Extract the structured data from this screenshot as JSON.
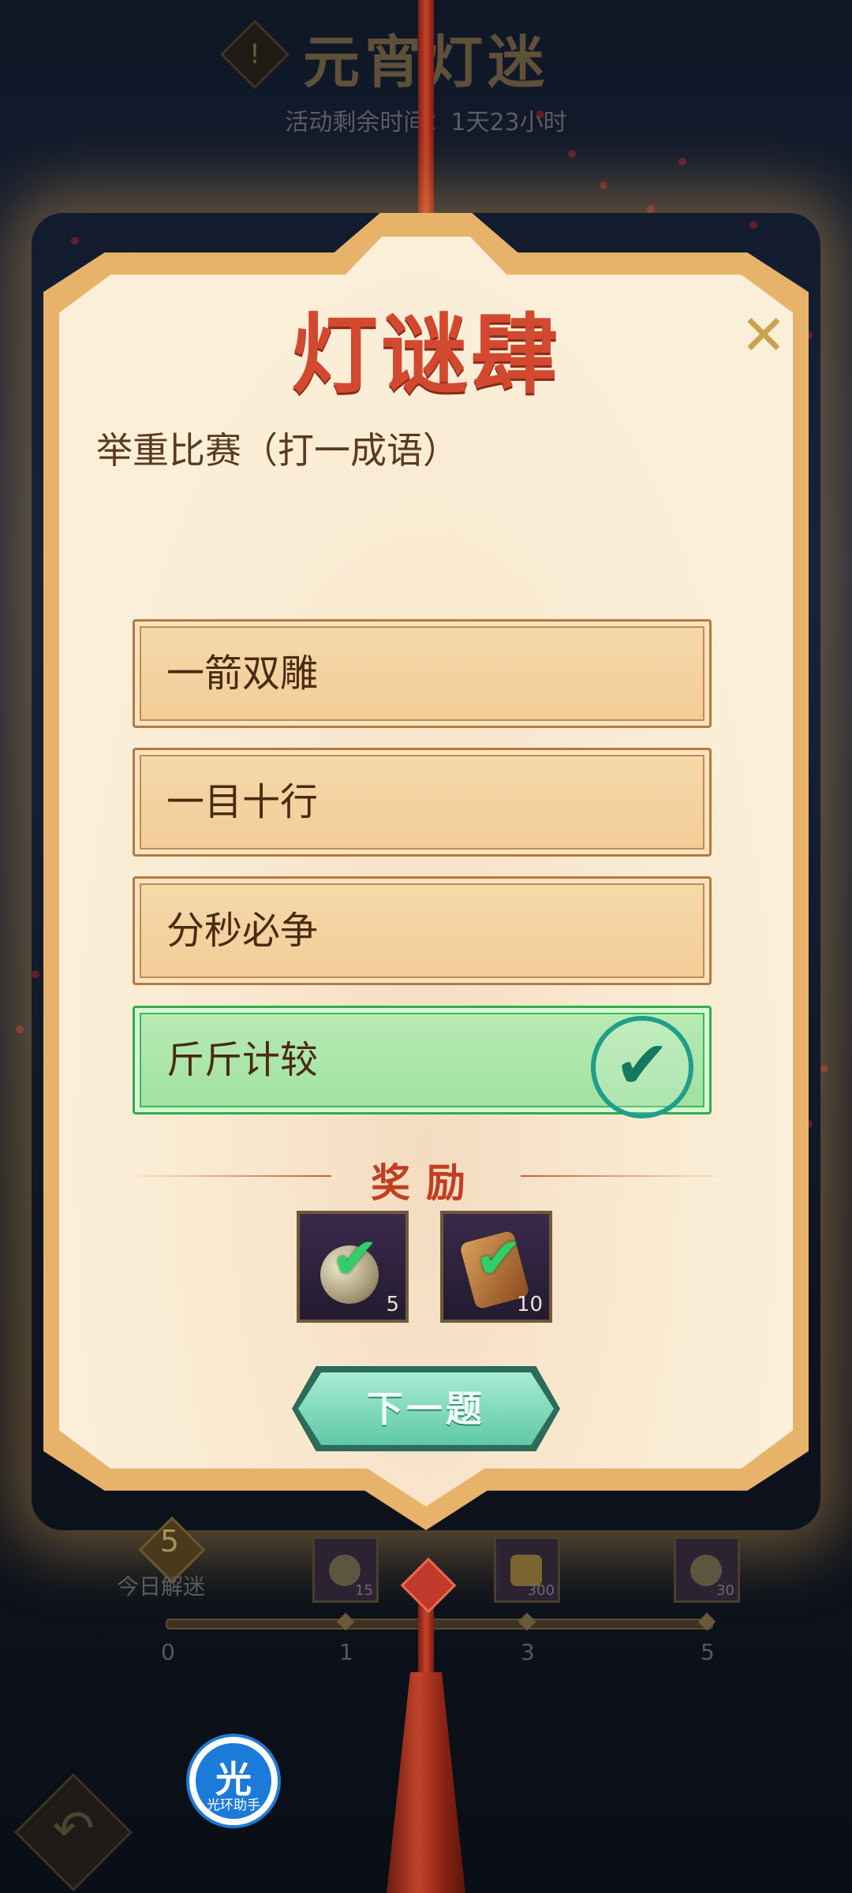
{
  "header": {
    "title": "元宵灯迷",
    "timer": "活动剩余时间：1天23小时",
    "info_glyph": "!"
  },
  "card": {
    "riddle_number": "灯谜肆",
    "close_glyph": "✕",
    "question": "举重比赛（打一成语）",
    "options": [
      {
        "label": "一箭双雕",
        "state": "normal"
      },
      {
        "label": "一目十行",
        "state": "normal"
      },
      {
        "label": "分秒必争",
        "state": "normal"
      },
      {
        "label": "斤斤计较",
        "state": "correct"
      }
    ],
    "check_glyph": "✔",
    "reward_title": "奖励",
    "rewards": [
      {
        "icon": "orb-item-icon",
        "count": "5"
      },
      {
        "icon": "scroll-item-icon",
        "count": "10"
      }
    ],
    "next_button": "下一题"
  },
  "progress": {
    "today_count": "5",
    "today_label": "今日解迷",
    "ticks": [
      "0",
      "1",
      "3",
      "5"
    ],
    "milestone_rewards": [
      {
        "icon": "orb-item-icon",
        "count": "15"
      },
      {
        "icon": "gold-ingot-icon",
        "count": "300"
      },
      {
        "icon": "orb-item-icon",
        "count": "30"
      }
    ]
  },
  "helper": {
    "main": "光",
    "sub": "光环助手"
  },
  "colors": {
    "accent_red": "#d2492f",
    "correct_green": "#2fae4f",
    "card_bg": "#fbefd9",
    "button_teal": "#5fc9a6"
  }
}
